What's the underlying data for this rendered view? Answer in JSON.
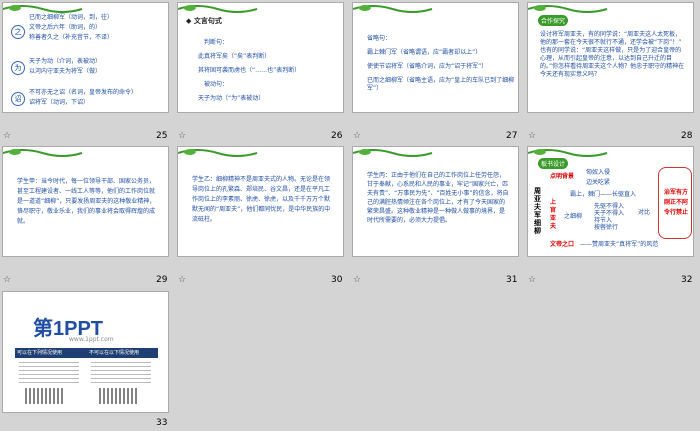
{
  "slides": [
    {
      "number": "25",
      "lines": [
        "已而之细柳军（动词，到，往）",
        "文帝之后六年（助词，的）",
        "称善者久之（补充音节，不译）",
        "天子为动（介词，表被动）",
        "以河内守亚夫为将军（做）",
        "不可亦无之诏（名词，皇帝发布的命令）",
        "诏将军（动词，下诏）"
      ],
      "circles": [
        "之",
        "为",
        "诏"
      ]
    },
    {
      "number": "26",
      "title": "◆ 文言句式",
      "lines": [
        "判断句：",
        "此真将军矣（“矣”表判断）",
        "其将固可袭而虏也（“……也”表判断）",
        "被动句：",
        "天子为动（“为”表被动）"
      ]
    },
    {
      "number": "27",
      "lines": [
        "省略句：",
        "霸上棘门军（省略谓语，应“霸者却以上”）",
        "使使节诏将军（省略介词，应为“诏于将军”）",
        "已而之细柳军（省略主语，应为“皇上的车队已到了细柳军”）"
      ]
    },
    {
      "number": "28",
      "header": "合作探究",
      "lines": [
        "设讨将军周亚夫，有的同学说：“周亚夫这人太死板，他的那一套在今天很不就行不通，还学会被“下岗”！” 也有的同学说：“周亚夫这样做，只是为了迎合皇帝的心理，从而引起皇帝的注意，以达到自己升迁的目的。”你怎样看待周亚夫这个人物？他忠于职守的精神在今天还有现实意义吗？"
      ]
    },
    {
      "number": "29",
      "lines": [
        "学生甲：当今时代，每一位领导干部、国家公务员，甚至工程建设者、一线工人等等，他们的工作岗位就是一道道“细柳”，只要发扬周亚夫的这种敬业精神，恪尽职守，敬业乐业，我们的事业将会取得辉煌的成就。"
      ]
    },
    {
      "number": "30",
      "lines": [
        "学生乙：细柳精神不是周亚夫式的人物。无论是在领导岗位上的孔繁森、郑培民、谷文昌，还是在平凡工作岗位上的李素丽、徐虎、徐虎，以及千千万万个默默无闻的“周亚夫”，他们都同忧民，是中华民族的中流砥柱。"
      ]
    },
    {
      "number": "31",
      "lines": [
        "学生丙：正由于他们在自己的工作岗位上任劳任怨，甘于奉献，心系民和人民的事业，牢记“国家兴亡，匹夫有责”、“万事民为先”、“百姓无小事”的信念，将自己的满腔热情倾注在各个岗位上，才有了今天国家的繁荣昌盛。这种敬业精神是一种做人做事的境界，是时代所需要的，必须大力提倡。"
      ]
    },
    {
      "number": "32",
      "header": "板书设计",
      "title": "周亚夫军细柳",
      "left": [
        "点明背景",
        "上官亚夫",
        "治军有方",
        "文帝之口"
      ],
      "mid": [
        "匈奴入侵",
        "边关吃紧",
        "霸上，棘门——长驱直入",
        "先驱不得入",
        "天子不得入",
        "持节入",
        "按辔徐行"
      ],
      "right": [
        "治军有方",
        "刚正不阿",
        "令行禁止"
      ],
      "foot": "——赞周亚夫“真将军”的风范",
      "contrast": "对比",
      "side": "之细柳"
    },
    {
      "number": "33",
      "logo": "第1PPT",
      "logo_sub": "www.1ppt.com",
      "col1": "可以在下列情况使用",
      "col2": "不可以在以下情况使用"
    }
  ],
  "colors": {
    "leaf": "#3a9a2a",
    "red": "#e00000",
    "blue": "#1f4ea3"
  }
}
